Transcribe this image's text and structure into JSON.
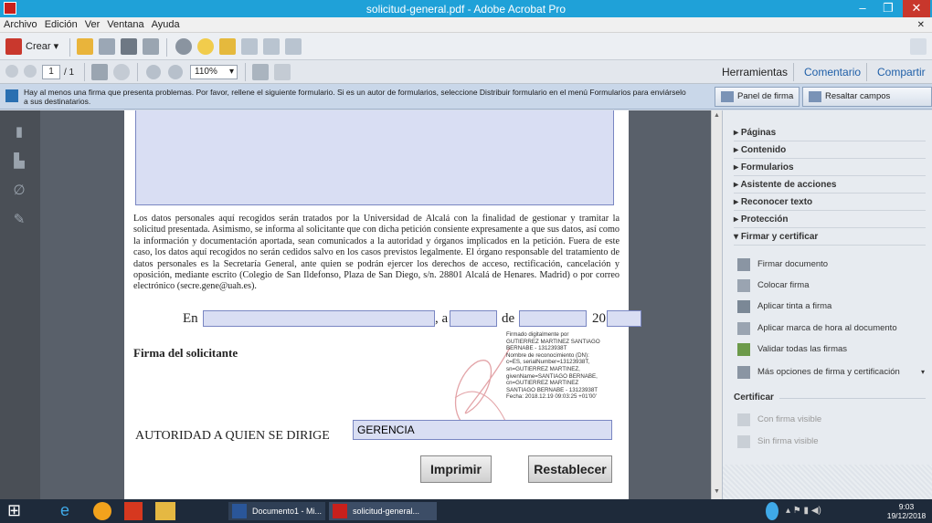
{
  "window": {
    "title": "solicitud-general.pdf - Adobe Acrobat Pro"
  },
  "menu": [
    "Archivo",
    "Edición",
    "Ver",
    "Ventana",
    "Ayuda"
  ],
  "toolbar": {
    "create_label": "Crear",
    "page_current": "1",
    "page_total": "/ 1",
    "zoom": "110%"
  },
  "right_links": {
    "tools": "Herramientas",
    "comment": "Comentario",
    "share": "Compartir"
  },
  "notice": {
    "message": "Hay al menos una firma que presenta problemas. Por favor, rellene el siguiente formulario. Si es un autor de formularios, seleccione Distribuir formulario en el menú Formularios para enviárselo a sus destinatarios.",
    "sign_panel": "Panel de firma",
    "highlight": "Resaltar campos existentes"
  },
  "document": {
    "paragraph": "Los datos personales aquí recogidos serán tratados por la Universidad de Alcalá con la finalidad de gestionar y tramitar la solicitud presentada. Asimismo, se informa al solicitante que con dicha petición consiente expresamente a que sus datos, así como la información y documentación aportada, sean comunicados a la autoridad y órganos implicados en la petición. Fuera de este caso, los datos aquí recogidos no serán cedidos salvo en los casos previstos legalmente. El órgano responsable del tratamiento de datos personales es la Secretaría General, ante quien se podrán ejercer los derechos de acceso, rectificación, cancelación y oposición, mediante escrito (Colegio de San Ildefonso, Plaza de San Diego, s/n. 28801 Alcalá de Henares. Madrid) o por correo electrónico (secre.gene@uah.es).",
    "en": "En",
    "a": ", a",
    "de": "de",
    "year": "20",
    "signature_label": "Firma del solicitante",
    "digital_signature": [
      "Firmado digitalmente por",
      "GUTIERREZ MARTINEZ SANTIAGO",
      "BERNABE - 13123938T",
      "Nombre de reconocimiento (DN):",
      "c=ES, serialNumber=13123938T,",
      "sn=GUTIERREZ MARTINEZ,",
      "givenName=SANTIAGO BERNABE,",
      "cn=GUTIERREZ MARTINEZ",
      "SANTIAGO BERNABE - 13123938T",
      "Fecha: 2018.12.19 09:03:25 +01'00'"
    ],
    "authority_label": "AUTORIDAD A QUIEN SE DIRIGE",
    "authority_value": "GERENCIA",
    "print_button": "Imprimir",
    "reset_button": "Restablecer"
  },
  "panel": {
    "sections": [
      "Páginas",
      "Contenido",
      "Formularios",
      "Asistente de acciones",
      "Reconocer texto",
      "Protección",
      "Firmar y certificar"
    ],
    "items": [
      "Firmar documento",
      "Colocar firma",
      "Aplicar tinta a firma",
      "Aplicar marca de hora al documento",
      "Validar todas las firmas",
      "Más opciones de firma y certificación"
    ],
    "certify_header": "Certificar",
    "certify_items": [
      "Con firma visible",
      "Sin firma visible"
    ]
  },
  "taskbar": {
    "word": "Documento1 - Mi...",
    "acrobat": "solicitud-general...",
    "time": "9:03",
    "date": "19/12/2018"
  }
}
